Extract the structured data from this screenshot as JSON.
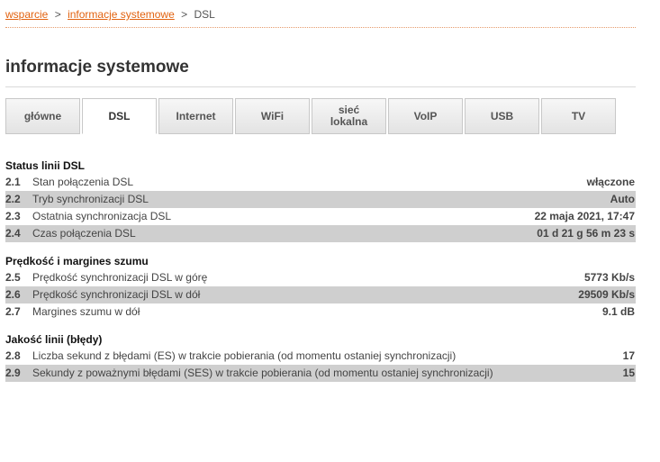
{
  "breadcrumb": {
    "item1": "wsparcie",
    "separator": ">",
    "item2": "informacje systemowe",
    "current": "DSL"
  },
  "page_title": "informacje systemowe",
  "tabs": [
    {
      "label": "główne",
      "active": false
    },
    {
      "label": "DSL",
      "active": true
    },
    {
      "label": "Internet",
      "active": false
    },
    {
      "label": "WiFi",
      "active": false
    },
    {
      "label": "sieć lokalna",
      "active": false
    },
    {
      "label": "VoIP",
      "active": false
    },
    {
      "label": "USB",
      "active": false
    },
    {
      "label": "TV",
      "active": false
    }
  ],
  "sections": [
    {
      "title": "Status linii DSL",
      "rows": [
        {
          "num": "2.1",
          "label": "Stan połączenia DSL",
          "value": "włączone"
        },
        {
          "num": "2.2",
          "label": "Tryb synchronizacji DSL",
          "value": "Auto"
        },
        {
          "num": "2.3",
          "label": "Ostatnia synchronizacja DSL",
          "value": "22 maja 2021, 17:47"
        },
        {
          "num": "2.4",
          "label": "Czas połączenia DSL",
          "value": "01 d 21 g 56 m 23 s"
        }
      ]
    },
    {
      "title": "Prędkość i margines szumu",
      "rows": [
        {
          "num": "2.5",
          "label": "Prędkość synchronizacji DSL w górę",
          "value": "5773 Kb/s"
        },
        {
          "num": "2.6",
          "label": "Prędkość synchronizacji DSL w dół",
          "value": "29509 Kb/s"
        },
        {
          "num": "2.7",
          "label": "Margines szumu w dół",
          "value": "9.1 dB"
        }
      ]
    },
    {
      "title": "Jakość linii (błędy)",
      "rows": [
        {
          "num": "2.8",
          "label": "Liczba sekund z błędami (ES) w trakcie pobierania (od momentu ostaniej synchronizacji)",
          "value": "17"
        },
        {
          "num": "2.9",
          "label": "Sekundy z poważnymi błędami (SES) w trakcie pobierania (od momentu ostaniej synchronizacji)",
          "value": "15"
        }
      ]
    }
  ],
  "colors": {
    "link": "#e2620f",
    "row_shade": "#cfcfcf"
  }
}
